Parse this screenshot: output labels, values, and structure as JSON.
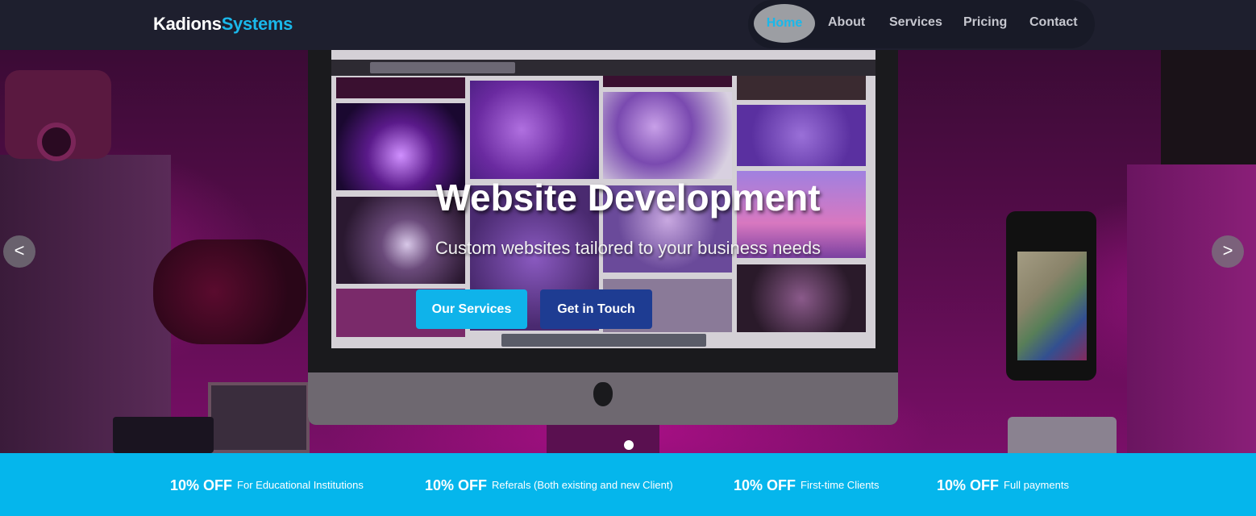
{
  "brand": {
    "name_part1": "Kadions",
    "name_part2": "Systems",
    "accent_color": "#1ab8ea"
  },
  "nav": {
    "items": [
      {
        "label": "Home",
        "active": true
      },
      {
        "label": "About"
      },
      {
        "label": "Services"
      },
      {
        "label": "Pricing"
      },
      {
        "label": "Contact"
      }
    ]
  },
  "hero": {
    "title": "Website Development",
    "subtitle": "Custom websites tailored to your business needs",
    "primary_button": "Our Services",
    "secondary_button": "Get in Touch",
    "prev_arrow": "<",
    "next_arrow": ">",
    "slide_count": 1,
    "active_slide": 1
  },
  "promos": [
    {
      "discount": "10% OFF",
      "label": "For Educational Institutions"
    },
    {
      "discount": "10% OFF",
      "label": "Referals (Both existing and new Client)"
    },
    {
      "discount": "10% OFF",
      "label": "First-time Clients"
    },
    {
      "discount": "10% OFF",
      "label": "Full payments"
    }
  ],
  "colors": {
    "header_bg": "#1e1f2e",
    "promo_bg": "#05b6ec",
    "primary_button": "#0fb3ea",
    "secondary_button": "#1e3c92"
  }
}
